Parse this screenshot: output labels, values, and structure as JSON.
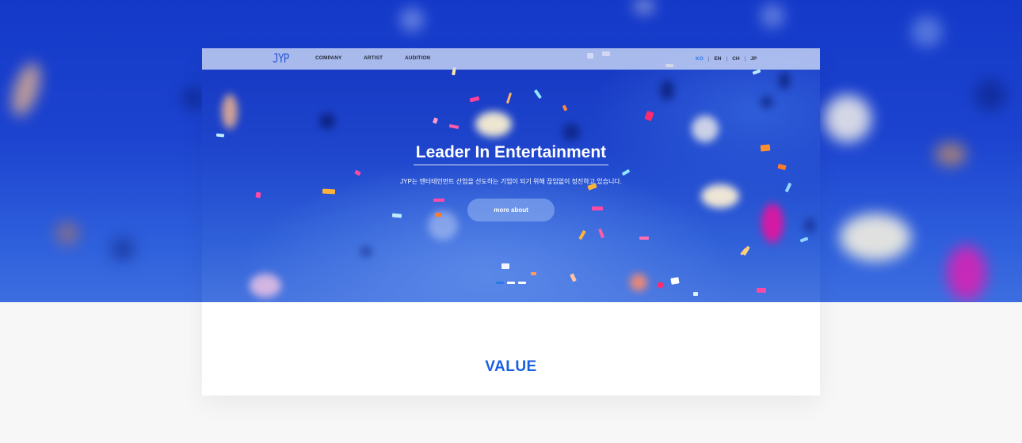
{
  "nav": {
    "logo": "JYP",
    "menu": [
      {
        "label": "COMPANY"
      },
      {
        "label": "ARTIST"
      },
      {
        "label": "AUDITION"
      }
    ],
    "languages": [
      {
        "label": "KO",
        "active": true
      },
      {
        "label": "EN",
        "active": false
      },
      {
        "label": "CH",
        "active": false
      },
      {
        "label": "JP",
        "active": false
      }
    ],
    "separator": "|"
  },
  "hero": {
    "title": "Leader In Entertainment",
    "subtitle": "JYP는 엔터테인먼트 산업을 선도하는 기업이 되기 위해 끊임없이 정진하고 있습니다.",
    "button_label": "more about",
    "slides": {
      "total": 3,
      "active": 0
    }
  },
  "sections": {
    "value_heading": "VALUE"
  },
  "colors": {
    "accent": "#1a5fe0",
    "active_lang": "#2a78e4",
    "hero_blue": "#1e45cc"
  }
}
